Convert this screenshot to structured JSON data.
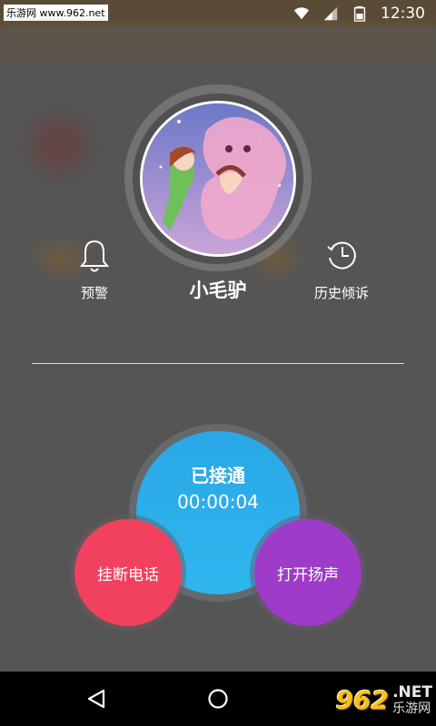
{
  "status_bar": {
    "watermark": "乐游网 www.962.net",
    "time": "12:30"
  },
  "contact": {
    "name": "小毛驴"
  },
  "actions": {
    "alert_label": "预警",
    "history_label": "历史倾诉"
  },
  "call": {
    "status": "已接通",
    "timer": "00:00:04",
    "hangup_label": "挂断电话",
    "speaker_label": "打开扬声"
  },
  "watermark_logo": {
    "number": "962",
    "net": ".NET",
    "name": "乐游网"
  },
  "colors": {
    "call_blue": "#2fb6ef",
    "hangup_red": "#f2405f",
    "speaker_purple": "#9f3bc9"
  }
}
